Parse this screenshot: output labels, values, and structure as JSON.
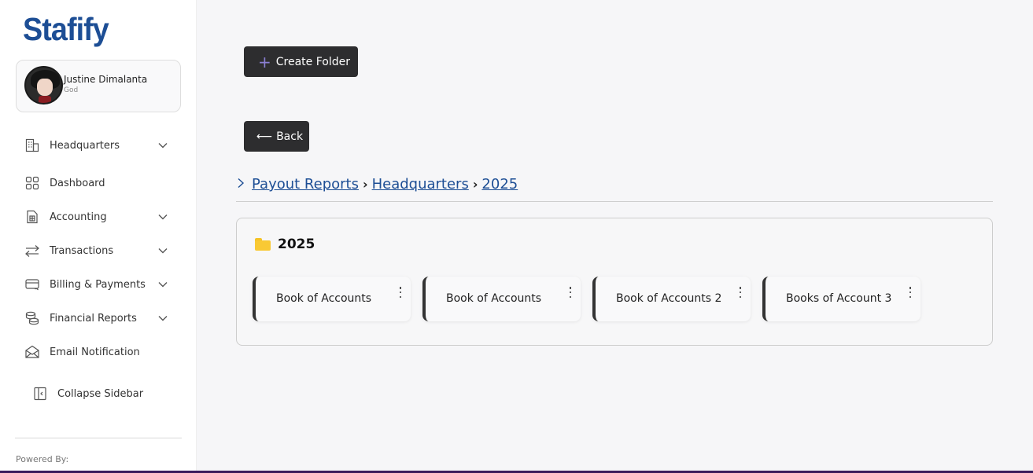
{
  "brand": "Stafify",
  "user": {
    "name": "Justine Dimalanta",
    "role": "God"
  },
  "nav": [
    {
      "label": "Headquarters",
      "icon": "building-icon",
      "has_chevron": true
    },
    {
      "label": "Dashboard",
      "icon": "grid-icon",
      "has_chevron": false
    },
    {
      "label": "Accounting",
      "icon": "calculator-icon",
      "has_chevron": true
    },
    {
      "label": "Transactions",
      "icon": "arrows-exchange-icon",
      "has_chevron": true
    },
    {
      "label": "Billing & Payments",
      "icon": "credit-card-icon",
      "has_chevron": true
    },
    {
      "label": "Financial Reports",
      "icon": "coins-icon",
      "has_chevron": true
    },
    {
      "label": "Email Notification",
      "icon": "envelope-icon",
      "has_chevron": false
    }
  ],
  "collapse_label": "Collapse Sidebar",
  "powered_by": "Powered By:",
  "toolbar": {
    "create_label": "Create Folder",
    "back_label": "Back"
  },
  "breadcrumb": [
    "Payout Reports",
    "Headquarters",
    "2025"
  ],
  "folder": {
    "title": "2025",
    "items": [
      {
        "label": "Book of Accounts"
      },
      {
        "label": "Book of Accounts"
      },
      {
        "label": "Book of Accounts 2"
      },
      {
        "label": "Books of Account 3"
      }
    ]
  },
  "colors": {
    "brand": "#1d4e95",
    "button": "#2d2d2f",
    "accent": "#8b7fd4",
    "folder": "#f9c934"
  }
}
